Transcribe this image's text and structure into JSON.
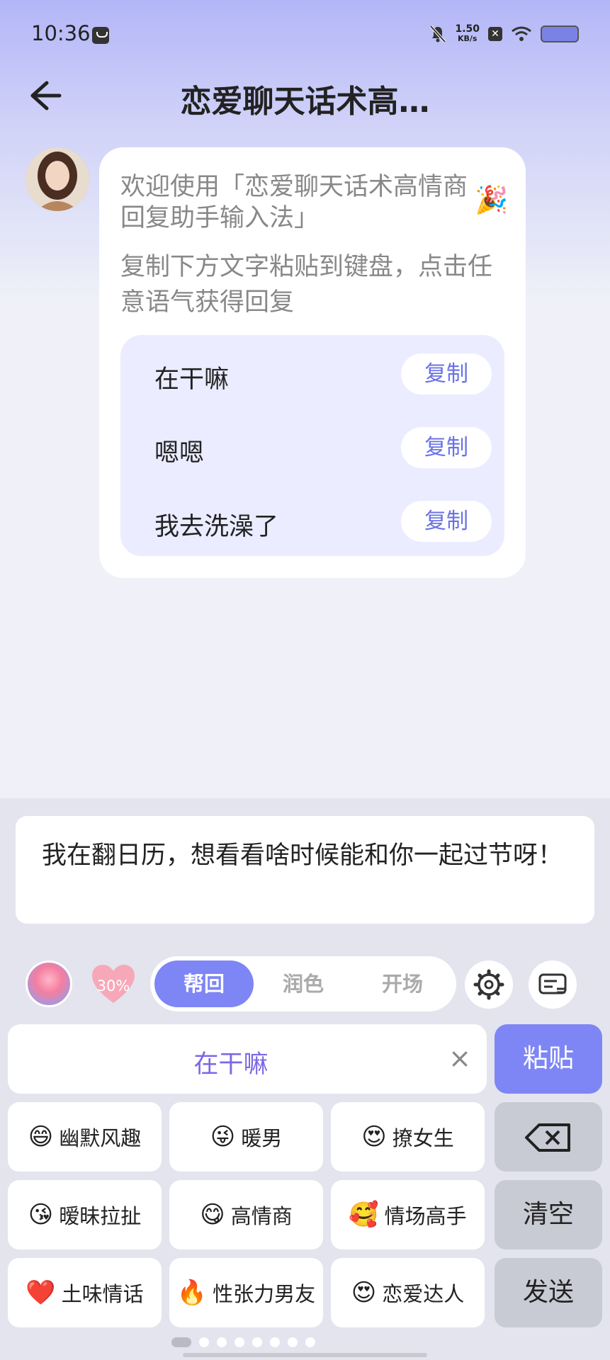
{
  "status_bar": {
    "time": "10:36",
    "net_speed_value": "1.50",
    "net_speed_unit": "KB/s"
  },
  "header": {
    "title": "恋爱聊天话术高…"
  },
  "chat": {
    "welcome": "欢迎使用「恋爱聊天话术高情商回复助手输入法」",
    "hint": "复制下方文字粘贴到键盘，点击任意语气获得回复",
    "phrases": [
      {
        "text": "在干嘛",
        "copy_label": "复制"
      },
      {
        "text": "嗯嗯",
        "copy_label": "复制"
      },
      {
        "text": "我去洗澡了",
        "copy_label": "复制"
      }
    ]
  },
  "input": {
    "value": "我在翻日历，想看看啥时候能和你一起过节呀！"
  },
  "toolbar": {
    "heart_percent": "30%",
    "tabs": [
      {
        "label": "帮回",
        "active": true
      },
      {
        "label": "润色",
        "active": false
      },
      {
        "label": "开场",
        "active": false
      }
    ]
  },
  "keyboard": {
    "current_phrase": "在干嘛",
    "paste_label": "粘贴",
    "clear_label": "清空",
    "send_label": "发送",
    "styles": [
      {
        "emoji": "😄",
        "label": "幽默风趣"
      },
      {
        "emoji": "😜",
        "label": "暖男"
      },
      {
        "emoji": "😍",
        "label": "撩女生"
      },
      {
        "emoji": "😘",
        "label": "暧昧拉扯"
      },
      {
        "emoji": "😋",
        "label": "高情商"
      },
      {
        "emoji": "🥰",
        "label": "情场高手"
      },
      {
        "emoji": "❤️",
        "label": "土味情话"
      },
      {
        "emoji": "🔥",
        "label": "性张力男友"
      },
      {
        "emoji": "😍",
        "label": "恋爱达人"
      }
    ],
    "page_dots": 8,
    "active_dot": 0
  },
  "colors": {
    "accent": "#7e86f5",
    "copy_text": "#6a72e6",
    "phrase_highlight": "#7b68e6"
  }
}
